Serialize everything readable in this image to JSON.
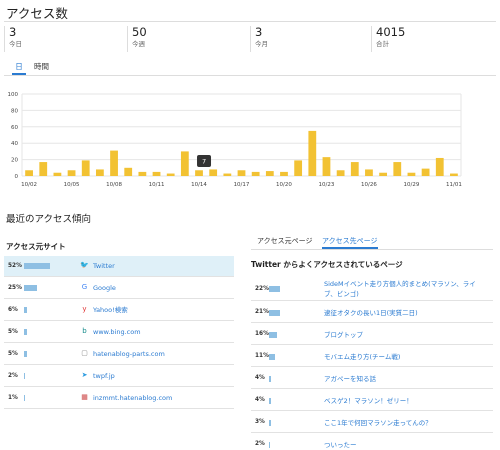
{
  "header": {
    "title": "アクセス数"
  },
  "stats": [
    {
      "value": "3",
      "label": "今日"
    },
    {
      "value": "50",
      "label": "今週"
    },
    {
      "value": "3",
      "label": "今月"
    },
    {
      "value": "4015",
      "label": "合計"
    }
  ],
  "period_tabs": [
    {
      "label": "日",
      "active": true
    },
    {
      "label": "時間",
      "active": false
    }
  ],
  "chart_data": {
    "type": "bar",
    "ylim": [
      0,
      100
    ],
    "yticks": [
      0,
      20,
      40,
      60,
      80,
      100
    ],
    "x_tick_labels": [
      "10/02",
      "10/05",
      "10/08",
      "10/11",
      "10/14",
      "10/17",
      "10/20",
      "10/23",
      "10/26",
      "10/29",
      "11/01"
    ],
    "values": [
      7,
      17,
      4,
      7,
      19,
      8,
      31,
      10,
      5,
      5,
      3,
      30,
      7,
      8,
      3,
      7,
      5,
      6,
      5,
      19,
      55,
      23,
      7,
      17,
      8,
      4,
      17,
      4,
      9,
      22,
      3
    ],
    "tooltip": {
      "label": "7"
    },
    "bar_color": "#f2c233",
    "grid": true
  },
  "trend": {
    "title": "最近のアクセス傾向"
  },
  "referrers": {
    "title": "アクセス元サイト",
    "items": [
      {
        "pct": "52%",
        "share": 52,
        "name": "Twitter",
        "icon": "twitter-icon"
      },
      {
        "pct": "25%",
        "share": 25,
        "name": "Google",
        "icon": "google-icon"
      },
      {
        "pct": "6%",
        "share": 6,
        "name": "Yahoo!検索",
        "icon": "yahoo-icon"
      },
      {
        "pct": "5%",
        "share": 5,
        "name": "www.bing.com",
        "icon": "bing-icon"
      },
      {
        "pct": "5%",
        "share": 5,
        "name": "hatenablog-parts.com",
        "icon": "page-icon"
      },
      {
        "pct": "2%",
        "share": 2,
        "name": "twpf.jp",
        "icon": "send-icon"
      },
      {
        "pct": "1%",
        "share": 1,
        "name": "inzmmt.hatenablog.com",
        "icon": "blog-favicon-icon"
      }
    ]
  },
  "right_tabs": [
    {
      "label": "アクセス元ページ",
      "active": false
    },
    {
      "label": "アクセス先ページ",
      "active": true
    }
  ],
  "targets": {
    "title": "Twitter からよくアクセスされているページ",
    "items": [
      {
        "pct": "22%",
        "share": 22,
        "lines": [
          "SideMイベント走り方個人的まとめ(マラソン、ライ",
          "ブ、ビンゴ)"
        ]
      },
      {
        "pct": "21%",
        "share": 21,
        "lines": [
          "逮征オタクの長い1日(実質二日)"
        ]
      },
      {
        "pct": "16%",
        "share": 16,
        "lines": [
          "ブログトップ"
        ]
      },
      {
        "pct": "11%",
        "share": 11,
        "lines": [
          "モバエム走り方(チーム戦)"
        ]
      },
      {
        "pct": "4%",
        "share": 4,
        "lines": [
          "アガペーを知る話"
        ]
      },
      {
        "pct": "4%",
        "share": 4,
        "lines": [
          "ベスゲ2！マラソン！ゼリー！"
        ]
      },
      {
        "pct": "3%",
        "share": 3,
        "lines": [
          "ここ1年で何回マラソン走ってんの？"
        ]
      },
      {
        "pct": "2%",
        "share": 2,
        "lines": [
          "ついったー"
        ]
      }
    ]
  }
}
